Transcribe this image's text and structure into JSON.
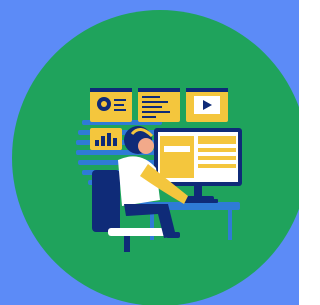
{
  "colors": {
    "background": "#5c8bf7",
    "circle": "#1fa35c",
    "accent_yellow": "#f4c63d",
    "navy": "#0f2b78",
    "stripes": "#2f7bd6",
    "white": "#ffffff",
    "skin": "#f2a98a"
  },
  "illustration": {
    "subject": "person-working-at-computer",
    "panels": [
      "settings-gear-icon",
      "code-lines-icon",
      "video-play-icon",
      "bar-chart-icon"
    ]
  }
}
